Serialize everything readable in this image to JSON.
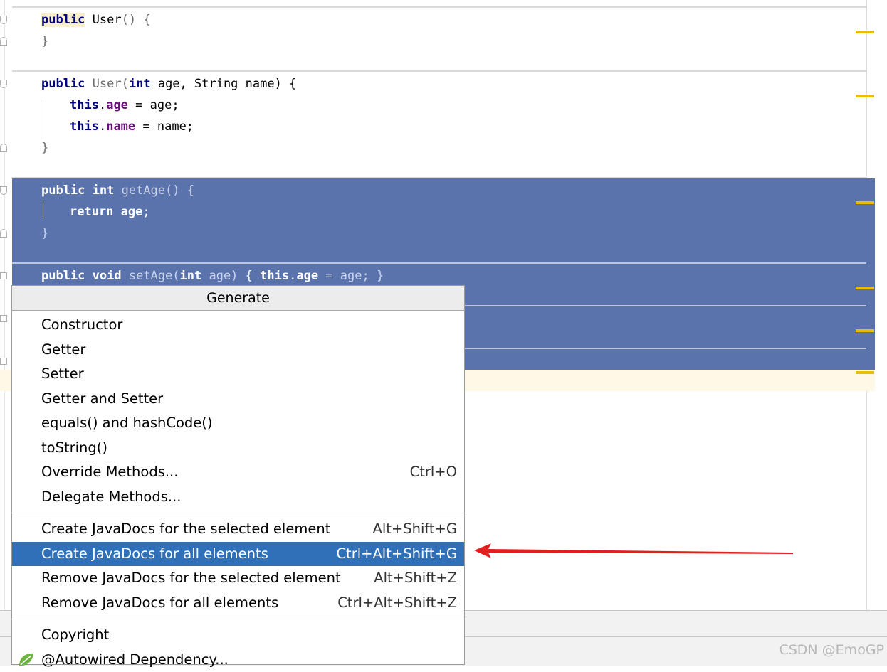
{
  "editor": {
    "lines": {
      "ctor1_sig": {
        "kw": "public",
        "name": "User",
        "rest": "() {"
      },
      "ctor1_close": "}",
      "ctor2_sig": {
        "kw": "public",
        "name": "User",
        "p1kw": "int",
        "p1": " age, String name) {"
      },
      "ctor2_l1": {
        "kw": "this",
        "fld": "age",
        "rest": " = age;"
      },
      "ctor2_l2": {
        "kw": "this",
        "fld": "name",
        "rest": " = name;"
      },
      "ctor2_close": "}",
      "getage_sig": {
        "kw": "public int",
        "name": "getAge",
        "rest": "() {"
      },
      "getage_body": {
        "kw": "return",
        "fld": "age",
        "rest": ";"
      },
      "getage_close": "}",
      "setage_sig": {
        "kw": "public void",
        "name": "setAge",
        "p": "(",
        "pkw": "int",
        "p2": " age)",
        "body_open": "{",
        "kw2": "this",
        "fld": "age",
        "rest": " = age; }"
      }
    }
  },
  "popup": {
    "title": "Generate",
    "group1": [
      {
        "label": "Constructor",
        "shortcut": ""
      },
      {
        "label": "Getter",
        "shortcut": ""
      },
      {
        "label": "Setter",
        "shortcut": ""
      },
      {
        "label": "Getter and Setter",
        "shortcut": ""
      },
      {
        "label": "equals() and hashCode()",
        "shortcut": ""
      },
      {
        "label": "toString()",
        "shortcut": ""
      },
      {
        "label": "Override Methods...",
        "shortcut": "Ctrl+O"
      },
      {
        "label": "Delegate Methods...",
        "shortcut": ""
      }
    ],
    "group2": [
      {
        "label": "Create JavaDocs for the selected element",
        "shortcut": "Alt+Shift+G"
      },
      {
        "label": "Create JavaDocs for all elements",
        "shortcut": "Ctrl+Alt+Shift+G"
      },
      {
        "label": "Remove JavaDocs for the selected element",
        "shortcut": "Alt+Shift+Z"
      },
      {
        "label": "Remove JavaDocs for all elements",
        "shortcut": "Ctrl+Alt+Shift+Z"
      }
    ],
    "group3": [
      {
        "label": "Copyright",
        "shortcut": ""
      },
      {
        "label": "@Autowired Dependency...",
        "shortcut": ""
      }
    ],
    "active_item": "Create JavaDocs for all elements"
  },
  "watermark": "CSDN @EmoGP",
  "colors": {
    "selection": "#5a73ad",
    "active_menu": "#2f70b8",
    "arrow": "#e02020",
    "marker": "#e6c000"
  }
}
